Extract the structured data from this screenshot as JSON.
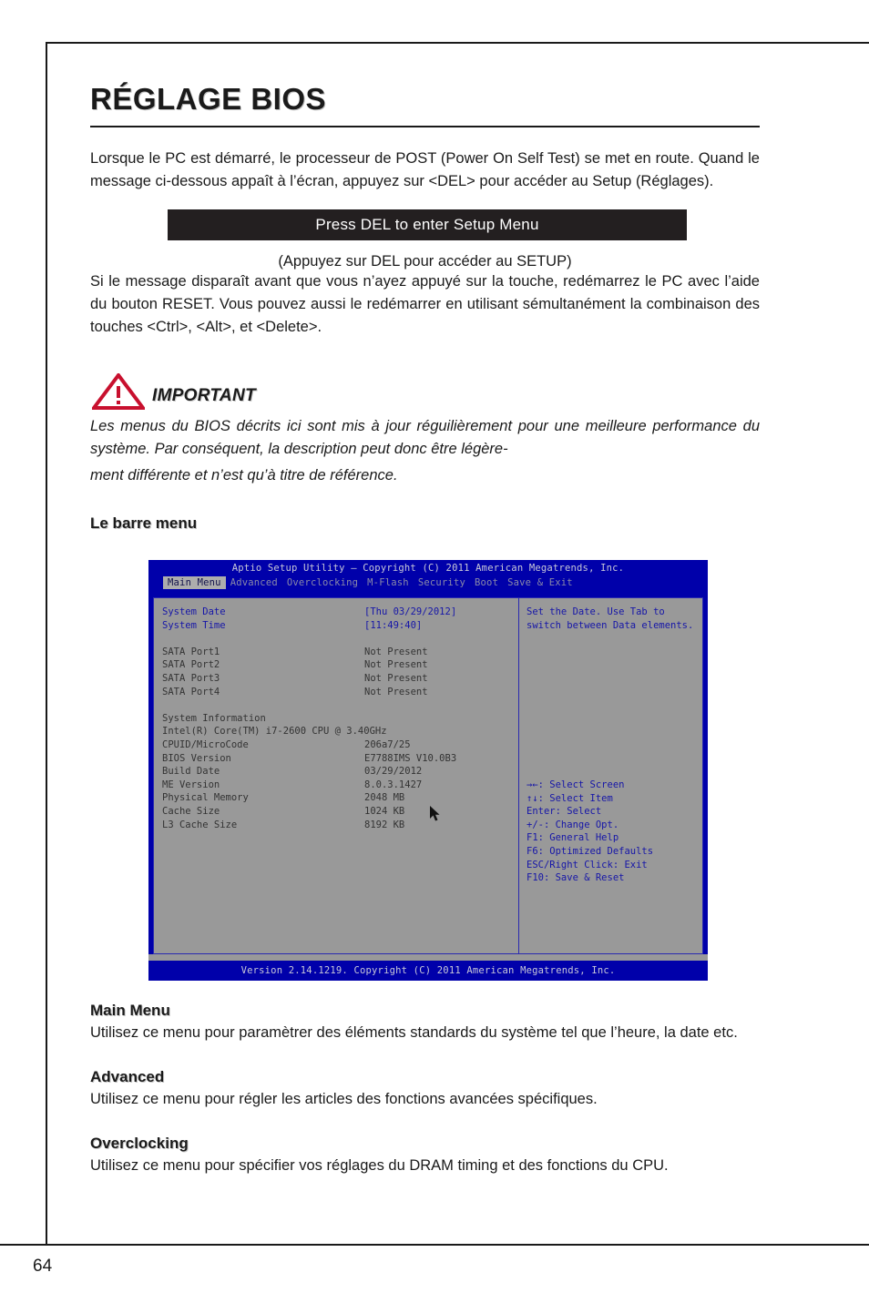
{
  "page": {
    "number": "64"
  },
  "heading": {
    "title": "RÉGLAGE BIOS"
  },
  "intro": {
    "paragraph": "Lorsque le PC est démarré, le processeur de POST (Power On Self Test) se met en route. Quand le message ci-dessous appaît à l’écran, appuyez sur <DEL> pour accéder au Setup (Réglages)."
  },
  "del_banner": {
    "text": "Press DEL to enter Setup Menu",
    "caption": "(Appuyez sur DEL pour accéder au SETUP)",
    "background_color": "#231f20"
  },
  "reset_note": {
    "paragraph": "Si le message disparaît avant que vous n’ayez appuyé sur la touche, redémarrez le PC avec l’aide du bouton RESET. Vous pouvez aussi le redémarrer en utilisant sémultanément la combinaison des touches <Ctrl>, <Alt>, et <Delete>."
  },
  "important": {
    "label": "IMPORTANT",
    "icon": "warning-triangle-icon",
    "icon_color": "#c8102e",
    "line1": "Les menus du BIOS décrits ici sont mis à jour réguilièrement pour une meilleure performance du système. Par conséquent, la description peut donc être légère-",
    "line2": "ment différente et n’est qu’à titre de référence."
  },
  "menubar_section": {
    "heading": "Le barre menu"
  },
  "bios": {
    "title": "Aptio Setup Utility – Copyright (C) 2011 American Megatrends, Inc.",
    "menu_items": [
      {
        "label": "Main Menu",
        "active": true
      },
      {
        "label": "Advanced",
        "active": false
      },
      {
        "label": "Overclocking",
        "active": false
      },
      {
        "label": "M-Flash",
        "active": false
      },
      {
        "label": "Security",
        "active": false
      },
      {
        "label": "Boot",
        "active": false
      },
      {
        "label": "Save & Exit",
        "active": false
      }
    ],
    "rows": [
      {
        "key": "System Date",
        "value": "[Thu 03/29/2012]",
        "color": "blue"
      },
      {
        "key": "System Time",
        "value": "[11:49:40]",
        "color": "blue"
      },
      {
        "key": "",
        "value": "",
        "color": "spacer"
      },
      {
        "key": "SATA Port1",
        "value": "Not Present",
        "color": "dark"
      },
      {
        "key": "SATA Port2",
        "value": "Not Present",
        "color": "dark"
      },
      {
        "key": "SATA Port3",
        "value": "Not Present",
        "color": "dark"
      },
      {
        "key": "SATA Port4",
        "value": "Not Present",
        "color": "dark"
      },
      {
        "key": "",
        "value": "",
        "color": "spacer"
      },
      {
        "key": "System Information",
        "value": "",
        "color": "dark"
      },
      {
        "key": "Intel(R) Core(TM) i7-2600 CPU @ 3.40GHz",
        "value": "",
        "color": "dark"
      },
      {
        "key": "CPUID/MicroCode",
        "value": "206a7/25",
        "color": "dark"
      },
      {
        "key": "BIOS Version",
        "value": "E7788IMS V10.0B3",
        "color": "dark"
      },
      {
        "key": "Build Date",
        "value": "03/29/2012",
        "color": "dark"
      },
      {
        "key": "ME Version",
        "value": "8.0.3.1427",
        "color": "dark"
      },
      {
        "key": "Physical Memory",
        "value": "2048 MB",
        "color": "dark"
      },
      {
        "key": "Cache Size",
        "value": "1024 KB",
        "color": "dark"
      },
      {
        "key": "L3 Cache Size",
        "value": "8192 KB",
        "color": "dark"
      }
    ],
    "help_text": "Set the Date. Use Tab to\nswitch between Data elements.",
    "help_keys": [
      "→←: Select Screen",
      "↑↓: Select Item",
      "Enter: Select",
      "+/-: Change Opt.",
      "F1: General Help",
      "F6: Optimized Defaults",
      "ESC/Right Click: Exit",
      "F10: Save & Reset"
    ],
    "footer": "Version 2.14.1219. Copyright (C) 2011 American Megatrends, Inc.",
    "colors": {
      "screen_blue": "#0000aa",
      "panel_gray": "#999999",
      "text_blue": "#1616a8",
      "highlight_gray": "#adadad"
    }
  },
  "sections": [
    {
      "heading": "Main Menu",
      "text": "Utilisez ce menu pour paramètrer des éléments standards du système tel que l’heure, la date etc."
    },
    {
      "heading": "Advanced",
      "text": "Utilisez ce menu pour régler les articles des fonctions avancées spécifiques."
    },
    {
      "heading": "Overclocking",
      "text": "Utilisez ce menu pour spécifier vos réglages du DRAM timing et des fonctions du CPU."
    }
  ]
}
